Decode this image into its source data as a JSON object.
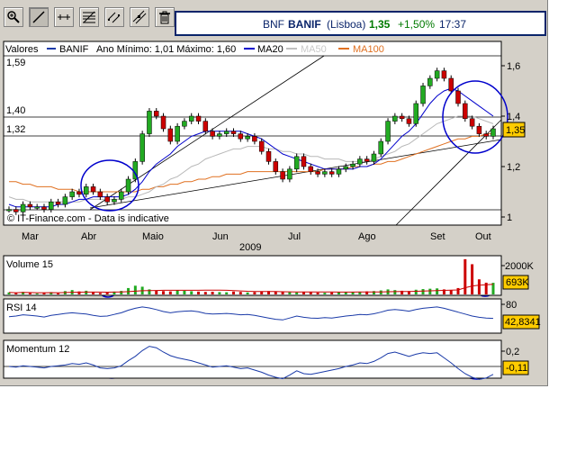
{
  "toolbar": {
    "buttons": [
      {
        "name": "zoom-tool-button",
        "icon": "magnifier-icon"
      },
      {
        "name": "draw-line-tool-button",
        "icon": "diagonal-line-icon"
      },
      {
        "name": "horizontal-line-tool-button",
        "icon": "horizontal-line-icon"
      },
      {
        "name": "fibonacci-tool-button",
        "icon": "fibonacci-icon"
      },
      {
        "name": "parallel-lines-tool-button",
        "icon": "parallel-lines-icon"
      },
      {
        "name": "trend-channel-tool-button",
        "icon": "trend-channel-icon"
      },
      {
        "name": "delete-tool-button",
        "icon": "trash-icon"
      }
    ]
  },
  "quote": {
    "ticker": "BNF",
    "name": "BANIF",
    "market": "(Lisboa)",
    "price": "1,35",
    "change": "+1,50%",
    "time": "17:37",
    "colors": {
      "name": "#0a246a",
      "price": "#007a00",
      "change": "#007a00"
    }
  },
  "main_legend": {
    "valores": "Valores",
    "banif": "BANIF",
    "range": "Ano Mínimo: 1,01 Máximo: 1,60",
    "ma20": "MA20",
    "ma50": "MA50",
    "ma100": "MA100",
    "colors": {
      "banif": "#1a3aa8",
      "ma20": "#0000cc",
      "ma50": "#c0c0c0",
      "ma100": "#e07020"
    }
  },
  "price_axis": {
    "right_ticks": [
      "1,6",
      "1,4",
      "1,2",
      "1"
    ],
    "left_labels": [
      "1,59",
      "1,40",
      "1,32"
    ],
    "current_value": "1,35"
  },
  "time_axis": {
    "months": [
      "Mar",
      "Abr",
      "Maio",
      "Jun",
      "Jul",
      "Ago",
      "Set",
      "Out"
    ],
    "year": "2009"
  },
  "credit": "© IT-Finance.com - Data is indicative",
  "volume_panel": {
    "label": "Volume 15",
    "tick": "2000K",
    "current_value": "693K"
  },
  "rsi_panel": {
    "label": "RSI 14",
    "tick": "80",
    "current_value": "42,8341"
  },
  "momentum_panel": {
    "label": "Momentum 12",
    "tick": "0,2",
    "current_value": "-0,11"
  },
  "chart_data": {
    "type": "line",
    "title": "BANIF",
    "ylim": [
      0.98,
      1.64
    ],
    "x_labels": [
      "Mar",
      "Abr",
      "Maio",
      "Jun",
      "Jul",
      "Ago",
      "Set",
      "Out"
    ],
    "series": [
      {
        "name": "BANIF",
        "values": [
          1.03,
          1.02,
          1.05,
          1.04,
          1.04,
          1.03,
          1.06,
          1.05,
          1.08,
          1.1,
          1.09,
          1.12,
          1.1,
          1.08,
          1.06,
          1.07,
          1.1,
          1.15,
          1.22,
          1.33,
          1.42,
          1.4,
          1.35,
          1.3,
          1.36,
          1.38,
          1.4,
          1.38,
          1.34,
          1.32,
          1.33,
          1.34,
          1.33,
          1.31,
          1.32,
          1.3,
          1.26,
          1.22,
          1.18,
          1.15,
          1.19,
          1.24,
          1.2,
          1.18,
          1.17,
          1.18,
          1.17,
          1.19,
          1.2,
          1.21,
          1.23,
          1.22,
          1.25,
          1.3,
          1.38,
          1.4,
          1.39,
          1.37,
          1.45,
          1.52,
          1.55,
          1.58,
          1.55,
          1.5,
          1.45,
          1.39,
          1.36,
          1.33,
          1.32,
          1.35
        ]
      },
      {
        "name": "MA20",
        "values": [
          1.05,
          1.04,
          1.04,
          1.04,
          1.04,
          1.04,
          1.04,
          1.05,
          1.05,
          1.06,
          1.07,
          1.07,
          1.08,
          1.08,
          1.08,
          1.08,
          1.08,
          1.09,
          1.11,
          1.14,
          1.18,
          1.21,
          1.23,
          1.25,
          1.28,
          1.3,
          1.32,
          1.33,
          1.34,
          1.34,
          1.34,
          1.34,
          1.34,
          1.34,
          1.33,
          1.32,
          1.31,
          1.29,
          1.27,
          1.25,
          1.24,
          1.23,
          1.22,
          1.21,
          1.2,
          1.19,
          1.19,
          1.19,
          1.19,
          1.19,
          1.2,
          1.2,
          1.21,
          1.23,
          1.26,
          1.29,
          1.32,
          1.34,
          1.37,
          1.41,
          1.45,
          1.48,
          1.5,
          1.51,
          1.5,
          1.48,
          1.46,
          1.44,
          1.42,
          1.4
        ]
      },
      {
        "name": "MA50",
        "values": [
          1.08,
          1.07,
          1.07,
          1.06,
          1.06,
          1.06,
          1.06,
          1.06,
          1.06,
          1.06,
          1.06,
          1.07,
          1.07,
          1.07,
          1.07,
          1.07,
          1.07,
          1.08,
          1.08,
          1.09,
          1.1,
          1.12,
          1.13,
          1.15,
          1.16,
          1.18,
          1.2,
          1.21,
          1.23,
          1.24,
          1.25,
          1.26,
          1.27,
          1.27,
          1.28,
          1.28,
          1.28,
          1.27,
          1.27,
          1.26,
          1.26,
          1.25,
          1.25,
          1.24,
          1.24,
          1.23,
          1.23,
          1.23,
          1.22,
          1.22,
          1.22,
          1.22,
          1.23,
          1.24,
          1.25,
          1.26,
          1.28,
          1.29,
          1.31,
          1.33,
          1.35,
          1.37,
          1.38,
          1.39,
          1.4,
          1.4,
          1.4,
          1.39,
          1.38,
          1.37
        ]
      },
      {
        "name": "MA100",
        "values": [
          1.14,
          1.14,
          1.13,
          1.13,
          1.12,
          1.12,
          1.12,
          1.11,
          1.11,
          1.11,
          1.1,
          1.1,
          1.1,
          1.1,
          1.1,
          1.1,
          1.1,
          1.1,
          1.1,
          1.11,
          1.11,
          1.12,
          1.12,
          1.13,
          1.13,
          1.14,
          1.14,
          1.15,
          1.15,
          1.16,
          1.16,
          1.17,
          1.17,
          1.17,
          1.18,
          1.18,
          1.18,
          1.18,
          1.18,
          1.18,
          1.18,
          1.18,
          1.18,
          1.18,
          1.18,
          1.19,
          1.19,
          1.19,
          1.19,
          1.2,
          1.2,
          1.2,
          1.21,
          1.21,
          1.22,
          1.22,
          1.23,
          1.24,
          1.25,
          1.26,
          1.27,
          1.28,
          1.29,
          1.3,
          1.31,
          1.31,
          1.32,
          1.32,
          1.33,
          1.33
        ]
      }
    ],
    "volume": [
      120,
      80,
      150,
      90,
      60,
      110,
      140,
      70,
      200,
      260,
      180,
      220,
      150,
      90,
      130,
      170,
      210,
      380,
      520,
      460,
      300,
      240,
      200,
      180,
      260,
      220,
      190,
      170,
      150,
      160,
      140,
      130,
      170,
      150,
      120,
      140,
      180,
      200,
      160,
      150,
      130,
      120,
      140,
      160,
      110,
      100,
      120,
      140,
      150,
      130,
      160,
      180,
      200,
      240,
      300,
      260,
      220,
      200,
      280,
      320,
      340,
      360,
      300,
      260,
      380,
      2100,
      1800,
      900,
      700,
      693
    ],
    "rsi": [
      48,
      50,
      54,
      52,
      50,
      47,
      52,
      55,
      58,
      60,
      58,
      56,
      52,
      49,
      50,
      55,
      60,
      68,
      74,
      78,
      75,
      70,
      64,
      60,
      63,
      65,
      66,
      63,
      58,
      56,
      57,
      58,
      56,
      54,
      55,
      52,
      48,
      44,
      40,
      38,
      44,
      50,
      46,
      44,
      43,
      45,
      44,
      47,
      50,
      52,
      55,
      54,
      57,
      62,
      68,
      70,
      68,
      65,
      70,
      74,
      76,
      78,
      74,
      68,
      62,
      56,
      50,
      46,
      44,
      42.83
    ],
    "momentum": [
      0.0,
      -0.01,
      0.01,
      0.0,
      -0.01,
      -0.02,
      0.0,
      0.01,
      0.02,
      0.04,
      0.03,
      0.05,
      0.02,
      -0.02,
      -0.03,
      -0.02,
      0.01,
      0.08,
      0.14,
      0.22,
      0.28,
      0.26,
      0.2,
      0.15,
      0.12,
      0.1,
      0.08,
      0.05,
      0.02,
      -0.01,
      0.0,
      0.01,
      -0.01,
      -0.03,
      -0.02,
      -0.05,
      -0.08,
      -0.12,
      -0.15,
      -0.17,
      -0.12,
      -0.06,
      -0.1,
      -0.11,
      -0.09,
      -0.07,
      -0.05,
      -0.03,
      0.0,
      0.02,
      0.05,
      0.04,
      0.07,
      0.12,
      0.18,
      0.2,
      0.17,
      0.14,
      0.17,
      0.19,
      0.18,
      0.19,
      0.12,
      0.05,
      -0.03,
      -0.1,
      -0.15,
      -0.18,
      -0.16,
      -0.11
    ]
  }
}
